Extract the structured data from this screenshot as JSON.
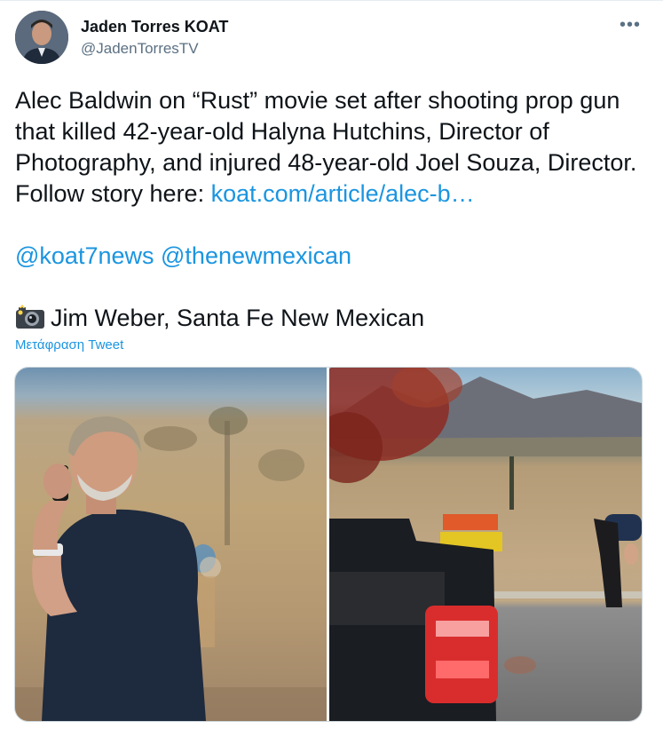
{
  "author": {
    "name": "Jaden Torres KOAT",
    "handle": "@JadenTorresTV"
  },
  "menu_label": "•••",
  "tweet": {
    "text_main": "Alec Baldwin on “Rust” movie set after shooting prop gun that killed 42-year-old Halyna Hutchins, Director of Photography, and injured 48-year-old Joel Souza, Director. Follow story here: ",
    "link_text": "koat.com/article/alec-b…",
    "mention_1": "@koat7news",
    "mention_2": "@thenewmexican",
    "credit": "Jim Weber, Santa Fe New Mexican"
  },
  "translate_label": "Μετάφραση Tweet",
  "colors": {
    "link": "#1b95e0",
    "text": "#0f1419",
    "secondary": "#5b7083"
  },
  "icons": {
    "more": "more-options-icon",
    "camera": "camera-icon"
  }
}
